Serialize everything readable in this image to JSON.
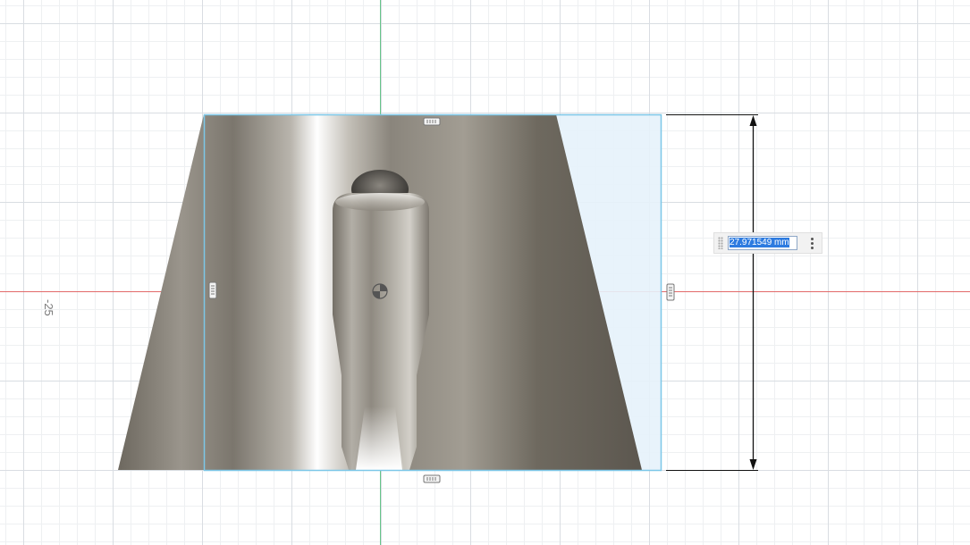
{
  "viewport": {
    "grid_axis_label": "-25",
    "colors": {
      "axis_x": "#e06060",
      "axis_y": "#5cbf80",
      "selection": "#7cc7e8",
      "dimension_line": "#111111",
      "body_metal": "#8a857c"
    }
  },
  "dimension": {
    "value_text": "27.971549 mm",
    "menu_icon": "more-vertical-icon"
  }
}
